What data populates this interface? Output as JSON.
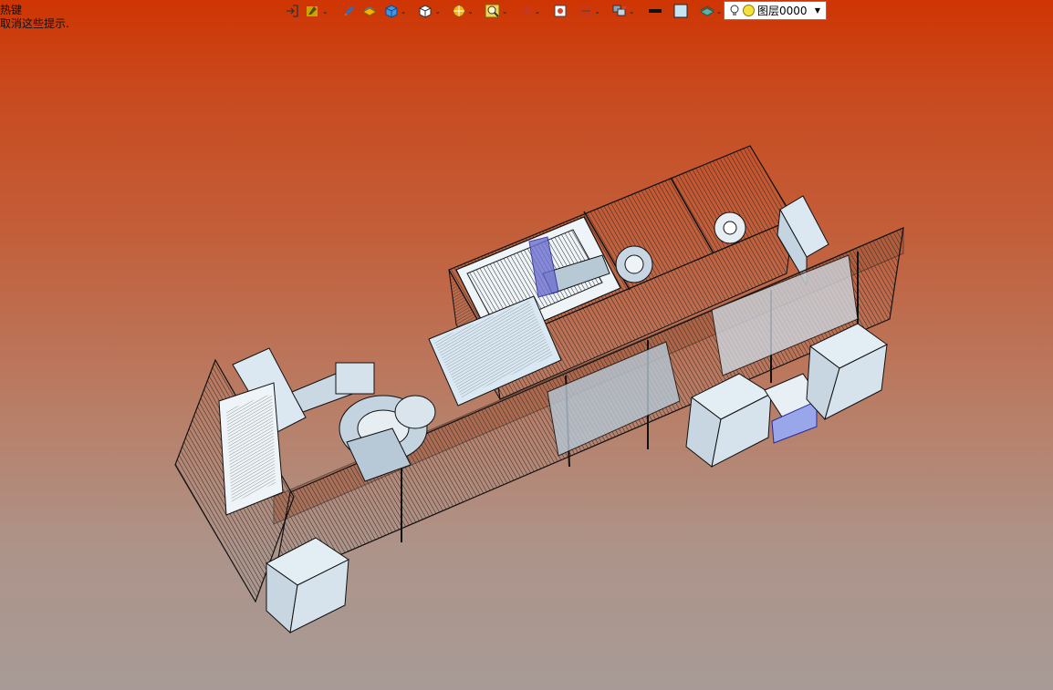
{
  "hint": {
    "line1": "热键",
    "line2": "取消这些提示."
  },
  "toolbar": {
    "buttons": [
      {
        "icon": "exit-sketch-icon",
        "dropdown": false
      },
      {
        "icon": "tool-settings-icon",
        "dropdown": true
      },
      {
        "icon": "pencil-icon",
        "dropdown": false
      },
      {
        "icon": "surface-body-icon",
        "dropdown": false
      },
      {
        "icon": "solid-body-icon",
        "dropdown": true
      },
      {
        "icon": "view-cube-icon",
        "dropdown": true
      },
      {
        "icon": "render-mode-icon",
        "dropdown": true
      },
      {
        "icon": "zoom-icon",
        "dropdown": true
      },
      {
        "icon": "pan-icon",
        "dropdown": true
      },
      {
        "icon": "view-fit-icon",
        "dropdown": false
      },
      {
        "icon": "section-view-icon",
        "dropdown": true
      },
      {
        "icon": "layer-manager-icon",
        "dropdown": true
      },
      {
        "icon": "line-color-icon",
        "dropdown": false
      },
      {
        "icon": "fill-color-icon",
        "dropdown": false
      },
      {
        "icon": "layer-stack-icon",
        "dropdown": true
      }
    ],
    "layer_name": "图层0000"
  }
}
